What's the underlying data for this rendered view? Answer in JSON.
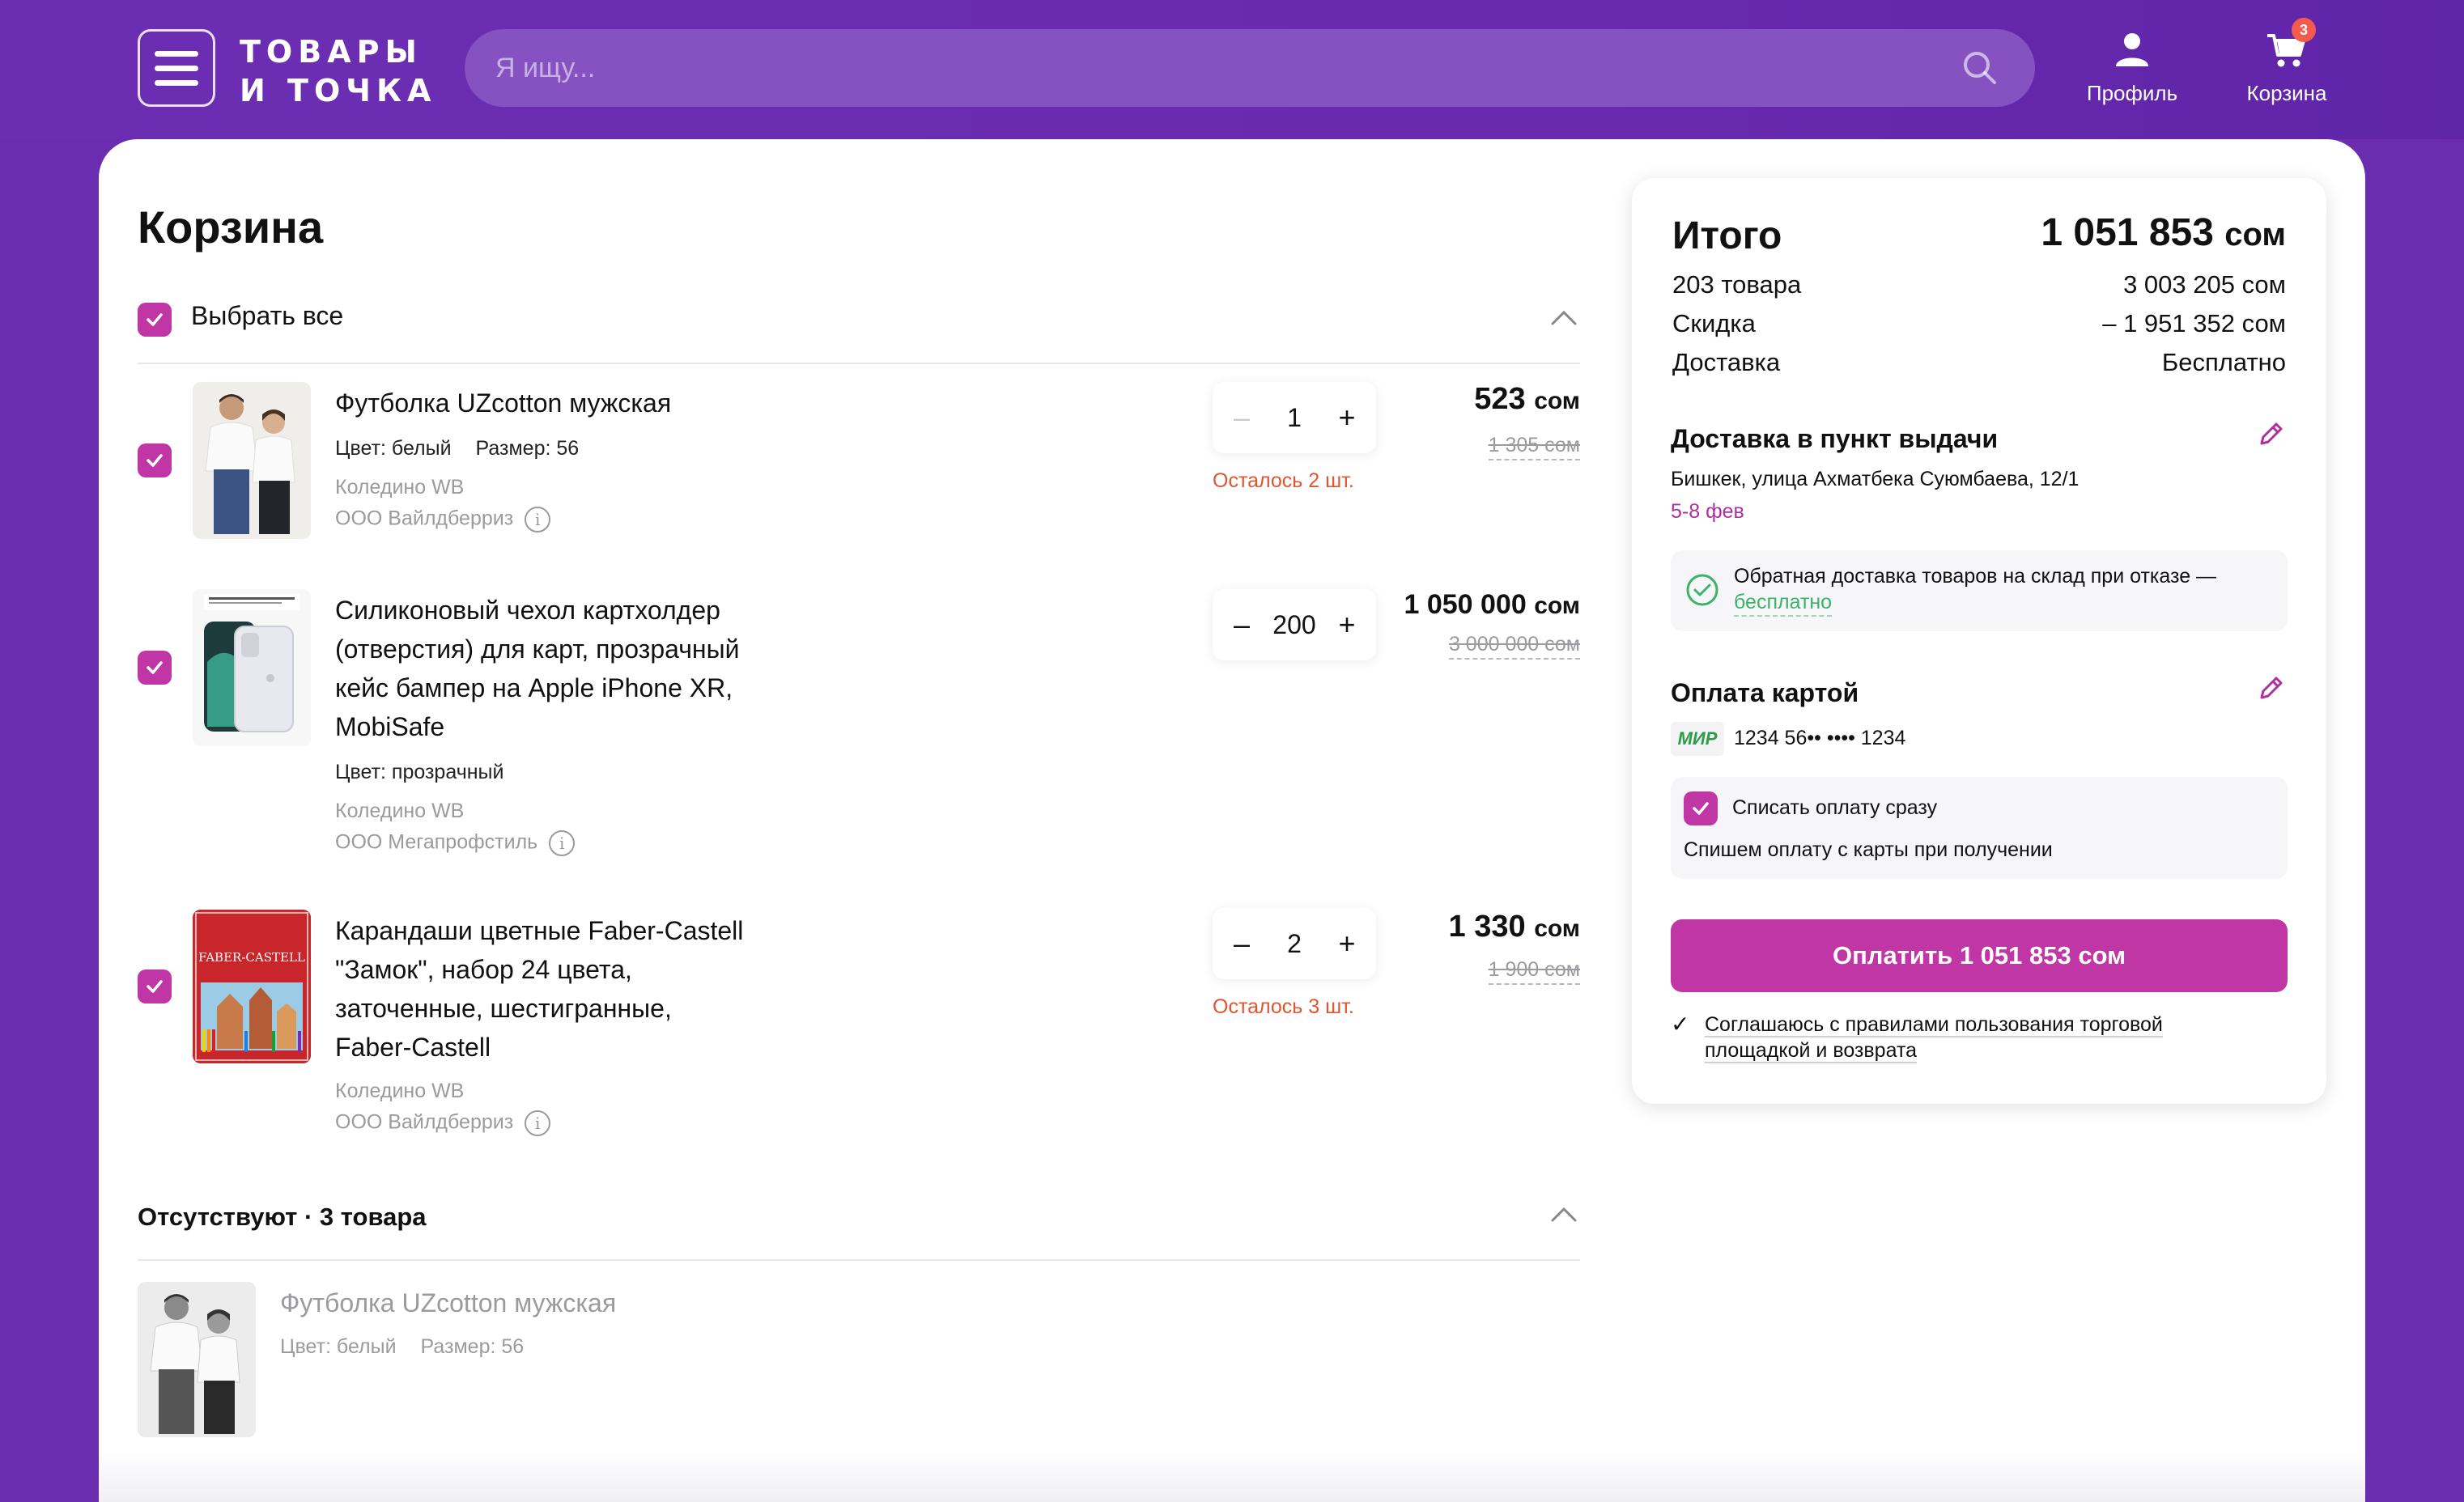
{
  "header": {
    "logo_line1": "ТОВАРЫ",
    "logo_line2": "И ТОЧКА",
    "search_placeholder": "Я ищу...",
    "profile_label": "Профиль",
    "cart_label": "Корзина",
    "cart_count": "3",
    "brand_color": "#6a2db0"
  },
  "cart": {
    "title": "Корзина",
    "select_all": "Выбрать все",
    "items": [
      {
        "title_lines": [
          "Футболка UZcotton мужская"
        ],
        "attr_color": "Цвет: белый",
        "attr_size": "Размер: 56",
        "warehouse": "Коледино WB",
        "seller": "ООО Вайлдберриз",
        "qty": "1",
        "stock_note": "Осталось 2 шт.",
        "price": "523",
        "currency": "сом",
        "old_price": "1 305 сом"
      },
      {
        "title_lines": [
          "Силиконовый чехол картхолдер",
          "(отверстия) для карт, прозрачный",
          "кейс бампер на Apple iPhone XR,",
          "MobiSafe"
        ],
        "attr_color": "Цвет: прозрачный",
        "warehouse": "Коледино WB",
        "seller": "ООО Мегапрофстиль",
        "qty": "200",
        "price": "1 050 000",
        "currency": "сом",
        "old_price": "3 000 000 сом"
      },
      {
        "title_lines": [
          "Карандаши цветные Faber-Castell",
          "\"Замок\", набор 24 цвета,",
          "заточенные, шестигранные,",
          "Faber-Castell"
        ],
        "warehouse": "Коледино WB",
        "seller": "ООО Вайлдберриз",
        "qty": "2",
        "stock_note": "Осталось 3 шт.",
        "price": "1 330",
        "currency": "сом",
        "old_price": "1 900 сом"
      }
    ],
    "absent": {
      "title": "Отсутствуют · 3 товара",
      "item_title": "Футболка UZcotton мужская",
      "attr_color": "Цвет: белый",
      "attr_size": "Размер: 56"
    }
  },
  "summary": {
    "total_label": "Итого",
    "total_value": "1 051 853",
    "currency": "сом",
    "rows": [
      {
        "label": "203 товара",
        "value": "3 003 205 сом"
      },
      {
        "label": "Скидка",
        "value": "– 1 951 352 сом"
      },
      {
        "label": "Доставка",
        "value": "Бесплатно"
      }
    ],
    "delivery_title": "Доставка в пункт выдачи",
    "delivery_address": "Бишкек, улица Ахматбека Суюмбаева, 12/1",
    "delivery_dates": "5-8 фев",
    "return_note": "Обратная доставка товаров на склад при отказе —",
    "return_free": "бесплатно",
    "payment_title": "Оплата картой",
    "card_brand": "МИР",
    "card_number": "1234 56•• •••• 1234",
    "charge_now": "Списать оплату сразу",
    "charge_note": "Спишем оплату с карты при получении",
    "pay_button": "Оплатить 1 051 853 сом",
    "agree_line1": "Соглашаюсь с правилами пользования торговой",
    "agree_line2": "площадкой и возврата",
    "accent_color": "#c036a4"
  }
}
